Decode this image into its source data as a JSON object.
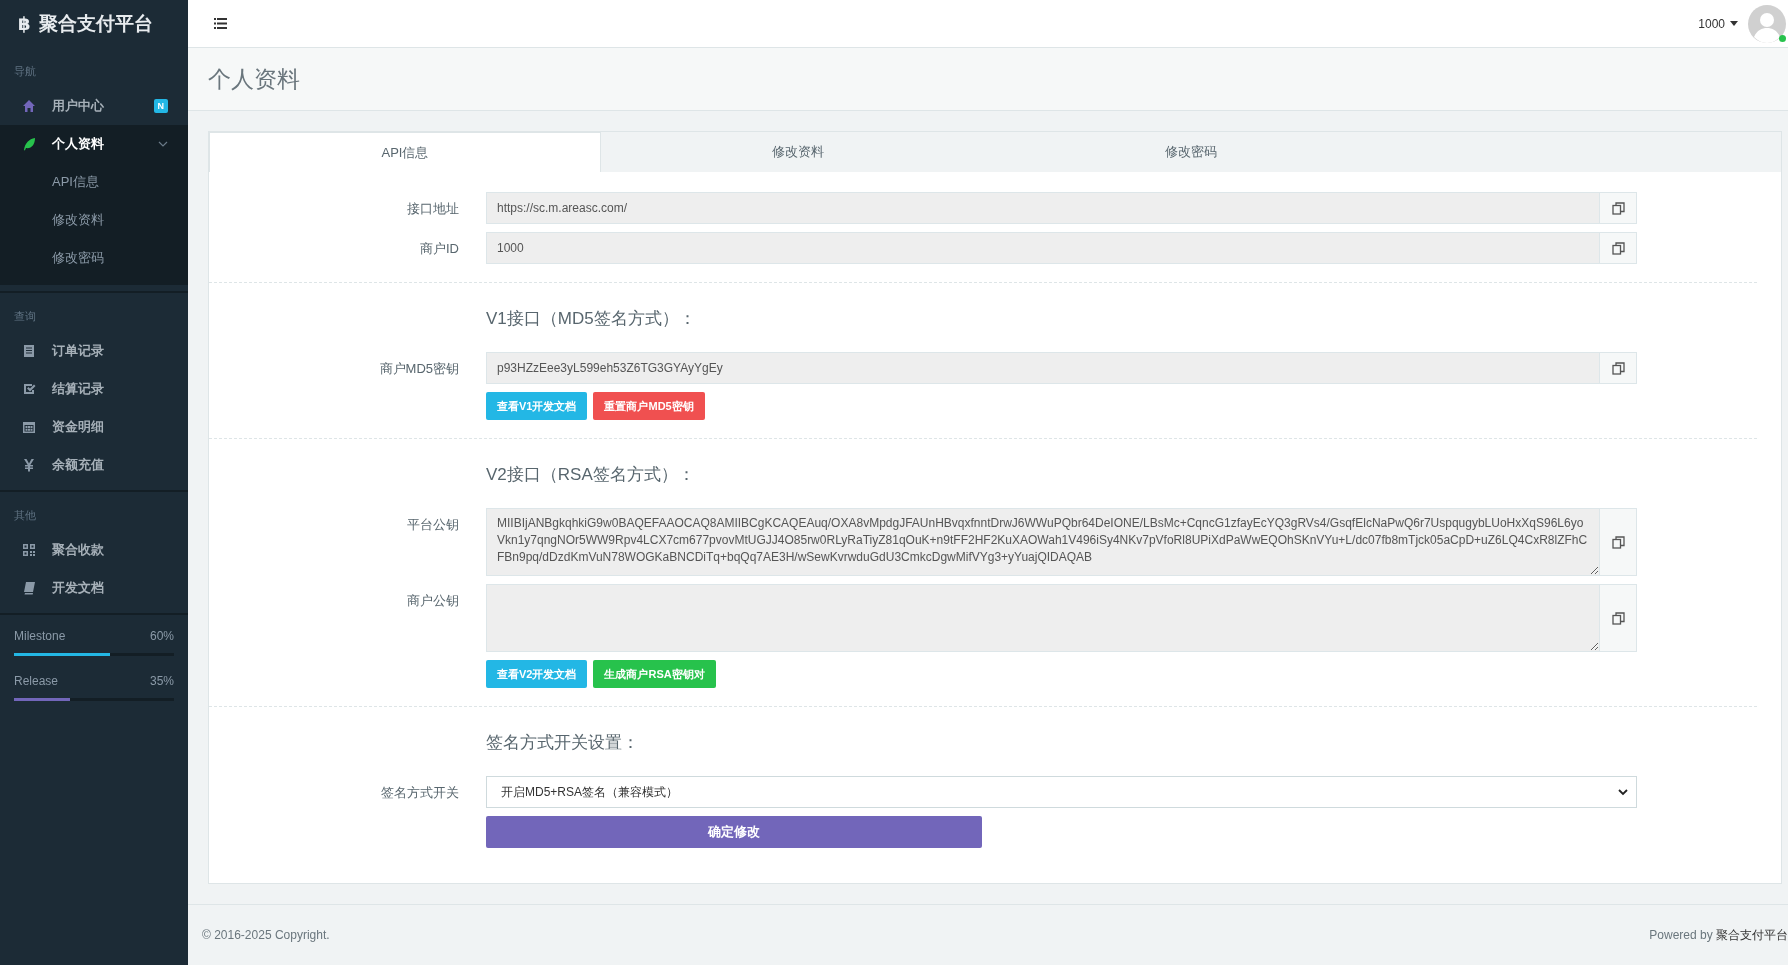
{
  "sidebar": {
    "logo_icon": "฿",
    "title": "聚合支付平台",
    "groups": [
      {
        "heading": "导航",
        "items": [
          {
            "label": "用户中心",
            "badge": "N",
            "selected": false
          },
          {
            "label": "个人资料",
            "selected": true,
            "expanded": true,
            "children": [
              {
                "label": "API信息"
              },
              {
                "label": "修改资料"
              },
              {
                "label": "修改密码"
              }
            ]
          }
        ]
      },
      {
        "heading": "查询",
        "items": [
          {
            "label": "订单记录",
            "selected": false
          },
          {
            "label": "结算记录",
            "selected": false
          },
          {
            "label": "资金明细",
            "selected": false
          },
          {
            "label": "余额充值",
            "selected": false
          }
        ]
      },
      {
        "heading": "其他",
        "items": [
          {
            "label": "聚合收款",
            "selected": false
          },
          {
            "label": "开发文档",
            "selected": false
          }
        ]
      }
    ],
    "progress": [
      {
        "label": "Milestone",
        "reading": "60%",
        "level": 0.6,
        "color": "#23b7e5"
      },
      {
        "label": "Release",
        "reading": "35%",
        "level": 0.35,
        "color": "#7266ba"
      }
    ]
  },
  "header": {
    "user": "1000",
    "online": true
  },
  "page_title": "个人资料",
  "tabs": [
    {
      "label": "API信息",
      "selected": true
    },
    {
      "label": "修改资料",
      "selected": false
    },
    {
      "label": "修改密码",
      "selected": false
    }
  ],
  "form": {
    "sections": [
      {
        "rows": [
          {
            "kind": "field",
            "label": "接口地址",
            "value": "https://sc.m.areasc.com/"
          },
          {
            "kind": "field",
            "label": "商户ID",
            "value": "1000"
          }
        ]
      },
      {
        "heading": "V1接口（MD5签名方式）：",
        "rows": [
          {
            "kind": "field",
            "label": "商户MD5密钥",
            "value": "p93HZzEee3yL599eh53Z6TG3GYAyYgEy"
          },
          {
            "kind": "buttons",
            "buttons": [
              {
                "label": "查看V1开发文档",
                "color": "#23b7e5"
              },
              {
                "label": "重置商户MD5密钥",
                "color": "#f05050"
              }
            ]
          }
        ]
      },
      {
        "heading": "V2接口（RSA签名方式）：",
        "rows": [
          {
            "kind": "textarea",
            "label": "平台公钥",
            "value": "MIIBIjANBgkqhkiG9w0BAQEFAAOCAQ8AMIIBCgKCAQEAuq/OXA8vMpdgJFAUnHBvqxfnntDrwJ6WWuPQbr64DeIONE/LBsMc+CqncG1zfayEcYQ3gRVs4/GsqfElcNaPwQ6r7UspqugybLUoHxXqS96L6yoVkn1y7qngNOr5WW9Rpv4LCX7cm677pvovMtUGJJ4O85rw0RLyRaTiyZ81qOuK+n9tFF2HF2KuXAOWah1V496iSy4NKv7pVfoRl8UPiXdPaWwEQOhSKnVYu+L/dc07fb8mTjck05aCpD+uZ6LQ4CxR8lZFhCFBn9pq/dDzdKmVuN78WOGKaBNCDiTq+bqQq7AE3H/wSewKvrwduGdU3CmkcDgwMifVYg3+yYuajQIDAQAB"
          },
          {
            "kind": "textarea",
            "label": "商户公钥"
          },
          {
            "kind": "buttons",
            "buttons": [
              {
                "label": "查看V2开发文档",
                "color": "#23b7e5"
              },
              {
                "label": "生成商户RSA密钥对",
                "color": "#27c24c"
              }
            ]
          }
        ]
      },
      {
        "heading": "签名方式开关设置：",
        "rows": [
          {
            "kind": "select",
            "label": "签名方式开关",
            "value": "开启MD5+RSA签名（兼容模式）"
          },
          {
            "kind": "submit",
            "label": "确定修改"
          }
        ]
      }
    ]
  },
  "footer": {
    "copyright": "© 2016-2025 Copyright.",
    "powered_prefix": "Powered by",
    "powered_name": "聚合支付平台"
  }
}
